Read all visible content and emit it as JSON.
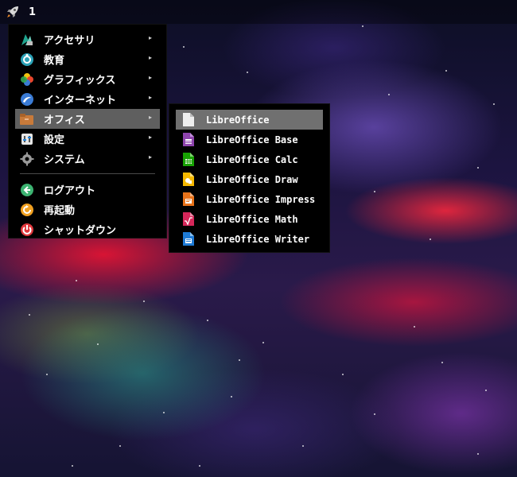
{
  "panel": {
    "workspace_number": "1",
    "launcher_icon": "rocket-icon"
  },
  "main_menu": {
    "items": [
      {
        "label": "アクセサリ",
        "icon": "accessories-icon",
        "color": "#1fa58f",
        "has_submenu": true
      },
      {
        "label": "教育",
        "icon": "education-icon",
        "color": "#2aa1b6",
        "has_submenu": true
      },
      {
        "label": "グラフィックス",
        "icon": "graphics-icon",
        "color": "#f08a1c",
        "has_submenu": true
      },
      {
        "label": "インターネット",
        "icon": "internet-icon",
        "color": "#3a7bd5",
        "has_submenu": true
      },
      {
        "label": "オフィス",
        "icon": "office-icon",
        "color": "#c87a3a",
        "has_submenu": true,
        "selected": true
      },
      {
        "label": "設定",
        "icon": "settings-icon",
        "color": "#8a8a8a",
        "has_submenu": true
      },
      {
        "label": "システム",
        "icon": "system-icon",
        "color": "#8a8a8a",
        "has_submenu": true
      },
      {
        "label": "ログアウト",
        "icon": "logout-icon",
        "color": "#3cb371"
      },
      {
        "label": "再起動",
        "icon": "reboot-icon",
        "color": "#f0a020"
      },
      {
        "label": "シャットダウン",
        "icon": "shutdown-icon",
        "color": "#e0383c"
      }
    ],
    "submenu_arrow": "▸"
  },
  "office_submenu": {
    "items": [
      {
        "label": "LibreOffice",
        "icon": "libreoffice-icon",
        "color": "#eeeeee",
        "selected": true
      },
      {
        "label": "LibreOffice Base",
        "icon": "libreoffice-base-icon",
        "color": "#8e44ad"
      },
      {
        "label": "LibreOffice Calc",
        "icon": "libreoffice-calc-icon",
        "color": "#18a303"
      },
      {
        "label": "LibreOffice Draw",
        "icon": "libreoffice-draw-icon",
        "color": "#f5b800"
      },
      {
        "label": "LibreOffice Impress",
        "icon": "libreoffice-impress-icon",
        "color": "#e8731a"
      },
      {
        "label": "LibreOffice Math",
        "icon": "libreoffice-math-icon",
        "color": "#d6275a"
      },
      {
        "label": "LibreOffice Writer",
        "icon": "libreoffice-writer-icon",
        "color": "#1e7bd6"
      }
    ]
  }
}
